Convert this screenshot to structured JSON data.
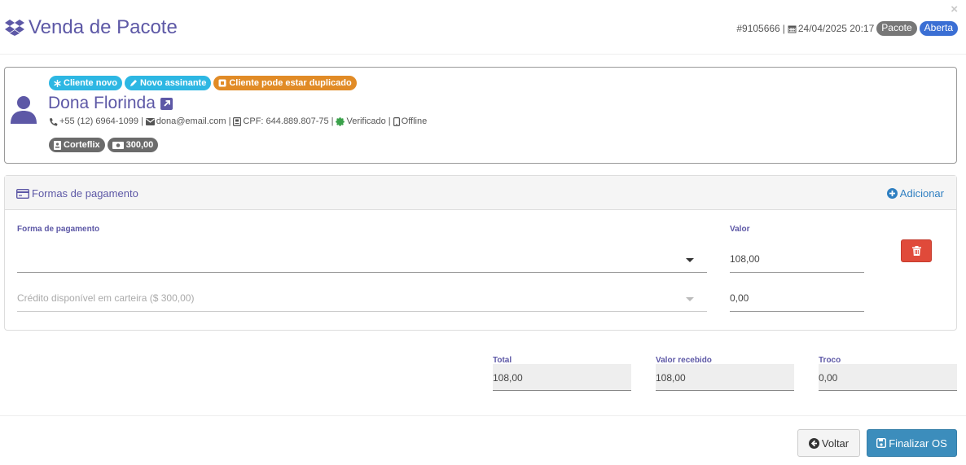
{
  "header": {
    "title": "Venda de Pacote",
    "order_id": "#9105666",
    "datetime": "24/04/2025 20:17",
    "badge_type": "Pacote",
    "badge_status": "Aberta",
    "close_label": "×"
  },
  "client": {
    "tags": [
      "Cliente novo",
      "Novo assinante",
      "Cliente pode estar duplicado"
    ],
    "name": "Dona Florinda",
    "phone": "+55 (12) 6964-1099",
    "email": "dona@email.com",
    "cpf": "CPF: 644.889.807-75",
    "verified": "Verificado",
    "device": "Offline",
    "plan": "Corteflix",
    "balance": "300,00"
  },
  "payments": {
    "title": "Formas de pagamento",
    "add_label": "Adicionar",
    "method_label": "Forma de pagamento",
    "value_label": "Valor",
    "rows": [
      {
        "method": "",
        "value": "108,00"
      },
      {
        "method": "Crédito disponível em carteira ($ 300,00)",
        "value": "0,00"
      }
    ]
  },
  "totals": {
    "total_label": "Total",
    "total_value": "108,00",
    "received_label": "Valor recebido",
    "received_value": "108,00",
    "change_label": "Troco",
    "change_value": "0,00"
  },
  "footer": {
    "back_label": "Voltar",
    "finish_label": "Finalizar OS"
  },
  "colors": {
    "accent": "#5d58a6",
    "primary": "#3c8dbc",
    "danger": "#e04a3a",
    "info": "#2db7e3",
    "warning": "#e18b26"
  }
}
